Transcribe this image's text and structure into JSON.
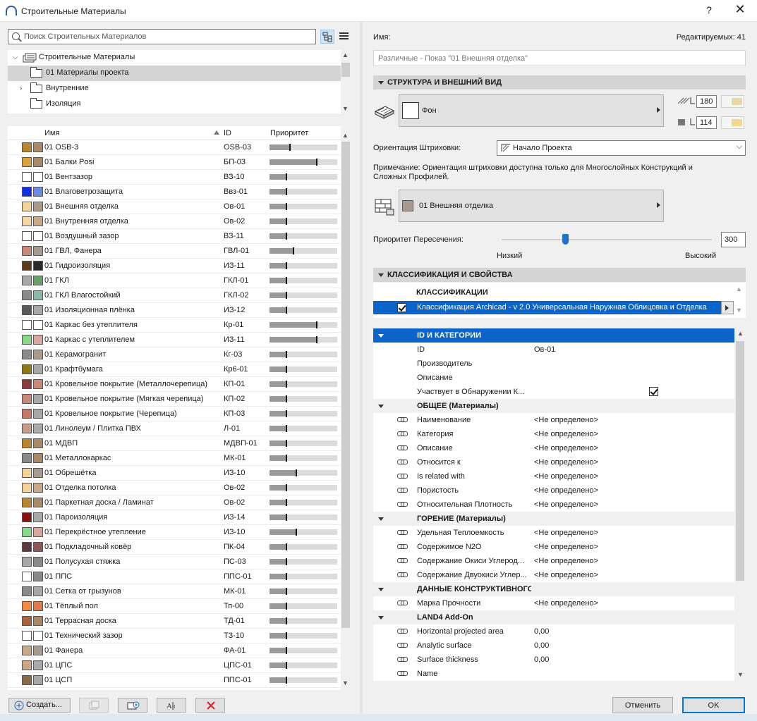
{
  "window": {
    "title": "Строительные Материалы",
    "help": "?",
    "close": "✕"
  },
  "search": {
    "placeholder": "Поиск Строительных Материалов"
  },
  "tree": {
    "root": "Строительные Материалы",
    "items": [
      {
        "label": "01 Материалы проекта",
        "selected": true
      },
      {
        "label": "Внутренние",
        "expandable": true
      },
      {
        "label": "Изоляция"
      }
    ]
  },
  "table": {
    "headers": {
      "name": "Имя",
      "id": "ID",
      "priority": "Приоритет"
    },
    "rows": [
      {
        "name": "01 OSB-3",
        "id": "OSB-03",
        "c1": "#b8862e",
        "c2": "#a88a6a",
        "p": 0.3
      },
      {
        "name": "01 Балки Posi",
        "id": "БП-03",
        "c1": "#d8a440",
        "c2": "#a88a6a",
        "p": 0.7
      },
      {
        "name": "01 Вентзазор",
        "id": "ВЗ-10",
        "c1": "#ffffff",
        "c2": "#ffffff",
        "p": 0.25
      },
      {
        "name": "01 Влаговетрозащита",
        "id": "Ввз-01",
        "c1": "#1030e0",
        "c2": "#6a8ae0",
        "p": 0.25
      },
      {
        "name": "01 Внешняя отделка",
        "id": "Ов-01",
        "c1": "#f2d49a",
        "c2": "#a89a8c",
        "p": 0.25
      },
      {
        "name": "01 Внутренняя отделка",
        "id": "Ов-02",
        "c1": "#f0d8a8",
        "c2": "#c8a888",
        "p": 0.25
      },
      {
        "name": "01 Воздушный зазор",
        "id": "ВЗ-11",
        "c1": "#ffffff",
        "c2": "#ffffff",
        "p": 0.25
      },
      {
        "name": "01 ГВЛ, Фанера",
        "id": "ГВЛ-01",
        "c1": "#c88a78",
        "c2": "#a89a8c",
        "p": 0.35
      },
      {
        "name": "01 Гидроизоляция",
        "id": "ИЗ-11",
        "c1": "#5a3a18",
        "c2": "#2a2a2a",
        "p": 0.25
      },
      {
        "name": "01 ГКЛ",
        "id": "ГКЛ-01",
        "c1": "#a8a8a8",
        "c2": "#6aa06a",
        "p": 0.25
      },
      {
        "name": "01 ГКЛ Влагостойкий",
        "id": "ГКЛ-02",
        "c1": "#8a8a8a",
        "c2": "#8abaa8",
        "p": 0.25
      },
      {
        "name": "01 Изоляционная плёнка",
        "id": "ИЗ-12",
        "c1": "#5a5a5a",
        "c2": "#a8a8a8",
        "p": 0.25
      },
      {
        "name": "01 Каркас без утеплителя",
        "id": "Кр-01",
        "c1": "#ffffff",
        "c2": "#ffffff",
        "p": 0.7
      },
      {
        "name": "01 Каркас с утеплителем",
        "id": "ИЗ-11",
        "c1": "#8ad88a",
        "c2": "#d8a8a0",
        "p": 0.7
      },
      {
        "name": "01 Керамогранит",
        "id": "Кг-03",
        "c1": "#8a8a8a",
        "c2": "#a89a8c",
        "p": 0.25
      },
      {
        "name": "01 Крафтбумага",
        "id": "Кр6-01",
        "c1": "#8a7a10",
        "c2": "#a8a8a8",
        "p": 0.25
      },
      {
        "name": "01 Кровельное покрытие (Металлочерепица)",
        "id": "КП-01",
        "c1": "#8a3a3a",
        "c2": "#c88a78",
        "p": 0.25
      },
      {
        "name": "01 Кровельное покрытие (Мягкая черепица)",
        "id": "КП-02",
        "c1": "#c88a78",
        "c2": "#a8a8a8",
        "p": 0.25
      },
      {
        "name": "01 Кровельное покрытие (Черепица)",
        "id": "КП-03",
        "c1": "#c87868",
        "c2": "#a8a8a8",
        "p": 0.25
      },
      {
        "name": "01 Линолеум / Плитка ПВХ",
        "id": "Л-01",
        "c1": "#c89a88",
        "c2": "#a8a8a8",
        "p": 0.25
      },
      {
        "name": "01 МДВП",
        "id": "МДВП-01",
        "c1": "#b8862e",
        "c2": "#a88a6a",
        "p": 0.25
      },
      {
        "name": "01 Металлокаркас",
        "id": "МК-01",
        "c1": "#8a8a8a",
        "c2": "#a88a6a",
        "p": 0.25
      },
      {
        "name": "01 Обрешётка",
        "id": "ИЗ-10",
        "c1": "#f2d49a",
        "c2": "#a89a8c",
        "p": 0.4
      },
      {
        "name": "01 Отделка потолка",
        "id": "Ов-02",
        "c1": "#f2d49a",
        "c2": "#c8a888",
        "p": 0.25
      },
      {
        "name": "01 Паркетная доска / Ламинат",
        "id": "Ов-02",
        "c1": "#b8862e",
        "c2": "#a88a6a",
        "p": 0.25
      },
      {
        "name": "01 Пароизоляция",
        "id": "ИЗ-14",
        "c1": "#8a1010",
        "c2": "#a8a8a8",
        "p": 0.25
      },
      {
        "name": "01 Перекрёстное утепление",
        "id": "ИЗ-10",
        "c1": "#8ad88a",
        "c2": "#d8a8a0",
        "p": 0.4
      },
      {
        "name": "01 Подкладочный ковёр",
        "id": "ПК-04",
        "c1": "#5a3a3a",
        "c2": "#8a5a5a",
        "p": 0.25
      },
      {
        "name": "01 Полусухая стяжка",
        "id": "ПС-03",
        "c1": "#a8a8a8",
        "c2": "#8a8a8a",
        "p": 0.25
      },
      {
        "name": "01 ППС",
        "id": "ППС-01",
        "c1": "#ffffff",
        "c2": "#8a8a8a",
        "p": 0.25
      },
      {
        "name": "01 Сетка от грызунов",
        "id": "МК-01",
        "c1": "#8a8a8a",
        "c2": "#a8a8a8",
        "p": 0.25
      },
      {
        "name": "01 Тёплый пол",
        "id": "Тп-00",
        "c1": "#f28a40",
        "c2": "#e07848",
        "p": 0.25
      },
      {
        "name": "01 Террасная доска",
        "id": "ТД-01",
        "c1": "#a8623e",
        "c2": "#a88a6a",
        "p": 0.25
      },
      {
        "name": "01 Технический зазор",
        "id": "ТЗ-10",
        "c1": "#ffffff",
        "c2": "#ffffff",
        "p": 0.25
      },
      {
        "name": "01 Фанера",
        "id": "ФА-01",
        "c1": "#c8a888",
        "c2": "#a89a8c",
        "p": 0.25
      },
      {
        "name": "01 ЦПС",
        "id": "ЦПС-01",
        "c1": "#c8a888",
        "c2": "#a8a8a8",
        "p": 0.25
      },
      {
        "name": "01 ЦСП",
        "id": "ППС-01",
        "c1": "#8a6a4a",
        "c2": "#a8a8a8",
        "p": 0.25
      }
    ]
  },
  "bottom_buttons": {
    "create": "Создать..."
  },
  "right": {
    "name_label": "Имя:",
    "editable_label": "Редактируемых: 41",
    "name_value": "Различные - Показ \"01 Внешняя отделка\"",
    "section_structure": "СТРУКТУРА И ВНЕШНИЙ ВИД",
    "fill_label": "Фон",
    "pen1": "180",
    "pen2": "114",
    "pen_color_1": "#e8d8a8",
    "pen_color_2": "#f0d890",
    "hatch_orient_label": "Ориентация Штриховки:",
    "hatch_orient_value": "Начало Проекта",
    "note": "Примечание: Ориентация штриховки доступна только для Многослойных Конструкций и Сложных Профилей.",
    "surface_label": "01 Внешняя отделка",
    "surface_color": "#a89a8c",
    "priority_label": "Приоритет Пересечения:",
    "priority_value": "300",
    "priority_low": "Низкий",
    "priority_high": "Высокий",
    "section_class": "КЛАССИФИКАЦИЯ И СВОЙСТВА",
    "class_header": "КЛАССИФИКАЦИИ",
    "class_value": "Классификация Archicad - v 2.0 Универсальная Наружная Облицовка и Отделка"
  },
  "props": [
    {
      "type": "group",
      "label": "ID И КАТЕГОРИИ",
      "selected": true
    },
    {
      "type": "row",
      "key": "ID",
      "value": "Ов-01",
      "link": false
    },
    {
      "type": "row",
      "key": "Производитель",
      "value": "",
      "link": false
    },
    {
      "type": "row",
      "key": "Описание",
      "value": "",
      "link": false
    },
    {
      "type": "check",
      "key": "Участвует в Обнаружении К...",
      "link": false
    },
    {
      "type": "group",
      "label": "ОБЩЕЕ (Материалы)"
    },
    {
      "type": "row",
      "key": "Наименование",
      "value": "<Не определено>",
      "link": true
    },
    {
      "type": "row",
      "key": "Категория",
      "value": "<Не определено>",
      "link": true
    },
    {
      "type": "row",
      "key": "Описание",
      "value": "<Не определено>",
      "link": true
    },
    {
      "type": "row",
      "key": "Относится к",
      "value": "<Не определено>",
      "link": true
    },
    {
      "type": "row",
      "key": "Is related with",
      "value": "<Не определено>",
      "link": true
    },
    {
      "type": "row",
      "key": "Пористость",
      "value": "<Не определено>",
      "link": true
    },
    {
      "type": "row",
      "key": "Относительная Плотность",
      "value": "<Не определено>",
      "link": true
    },
    {
      "type": "group",
      "label": "ГОРЕНИЕ (Материалы)"
    },
    {
      "type": "row",
      "key": "Удельная Теплоемкость",
      "value": "<Не определено>",
      "link": true
    },
    {
      "type": "row",
      "key": "Содержимое N2O",
      "value": "<Не определено>",
      "link": true
    },
    {
      "type": "row",
      "key": "Содержание Окиси Углерод...",
      "value": "<Не определено>",
      "link": true
    },
    {
      "type": "row",
      "key": "Содержание Двуокиси Углер...",
      "value": "<Не определено>",
      "link": true
    },
    {
      "type": "group",
      "label": "ДАННЫЕ КОНСТРУКТИВНОГО АНАЛИЗА"
    },
    {
      "type": "row",
      "key": "Марка Прочности",
      "value": "<Не определено>",
      "link": true
    },
    {
      "type": "group",
      "label": "LAND4 Add-On"
    },
    {
      "type": "row",
      "key": "Horizontal projected area",
      "value": "0,00",
      "link": true
    },
    {
      "type": "row",
      "key": "Analytic surface",
      "value": "0,00",
      "link": true
    },
    {
      "type": "row",
      "key": "Surface thickness",
      "value": "0,00",
      "link": true
    },
    {
      "type": "row",
      "key": "Name",
      "value": "",
      "link": true
    }
  ],
  "dialog": {
    "cancel": "Отменить",
    "ok": "OK"
  }
}
